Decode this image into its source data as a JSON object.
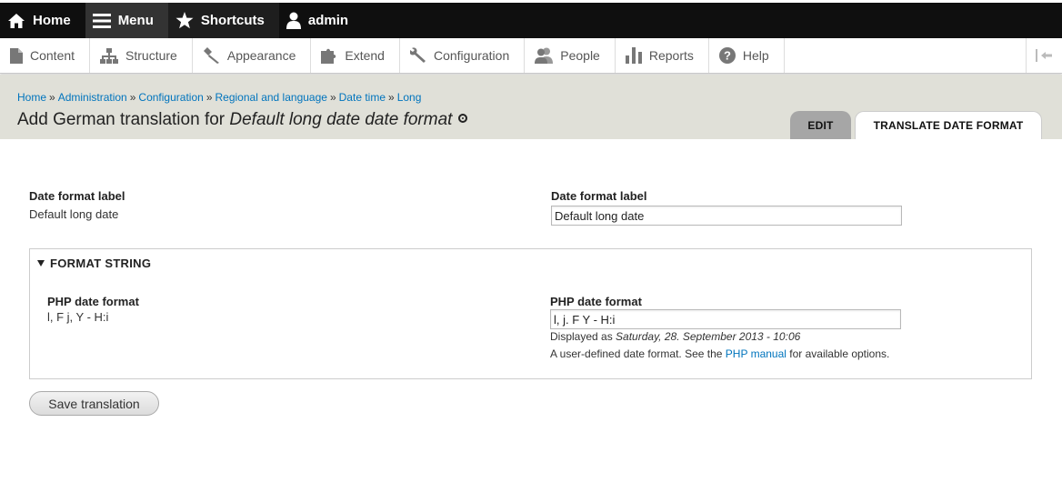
{
  "toolbar": {
    "home": "Home",
    "menu": "Menu",
    "shortcuts": "Shortcuts",
    "user": "admin"
  },
  "tray": {
    "items": [
      {
        "label": "Content",
        "icon": "file-icon"
      },
      {
        "label": "Structure",
        "icon": "sitemap-icon"
      },
      {
        "label": "Appearance",
        "icon": "paintbrush-icon"
      },
      {
        "label": "Extend",
        "icon": "puzzle-icon"
      },
      {
        "label": "Configuration",
        "icon": "wrench-icon"
      },
      {
        "label": "People",
        "icon": "people-icon"
      },
      {
        "label": "Reports",
        "icon": "bar-chart-icon"
      },
      {
        "label": "Help",
        "icon": "help-icon"
      }
    ]
  },
  "breadcrumb": [
    "Home",
    "Administration",
    "Configuration",
    "Regional and language",
    "Date time",
    "Long"
  ],
  "breadcrumb_sep": "»",
  "page": {
    "title_prefix": "Add German translation for ",
    "title_em": "Default long date date format"
  },
  "tabs": {
    "edit": "EDIT",
    "translate": "TRANSLATE DATE FORMAT"
  },
  "label_field": {
    "source_label": "Date format label",
    "source_value": "Default long date",
    "target_label": "Date format label",
    "target_value": "Default long date"
  },
  "format_fieldset": {
    "legend": "FORMAT STRING",
    "source_label": "PHP date format",
    "source_value": "l, F j, Y - H:i",
    "target_label": "PHP date format",
    "target_value": "l, j. F Y - H:i",
    "displayed_prefix": "Displayed as ",
    "displayed_value": "Saturday, 28. September 2013 - 10:06",
    "help_prefix": "A user-defined date format. See the ",
    "help_link": "PHP manual",
    "help_suffix": " for available options."
  },
  "save_button": "Save translation"
}
